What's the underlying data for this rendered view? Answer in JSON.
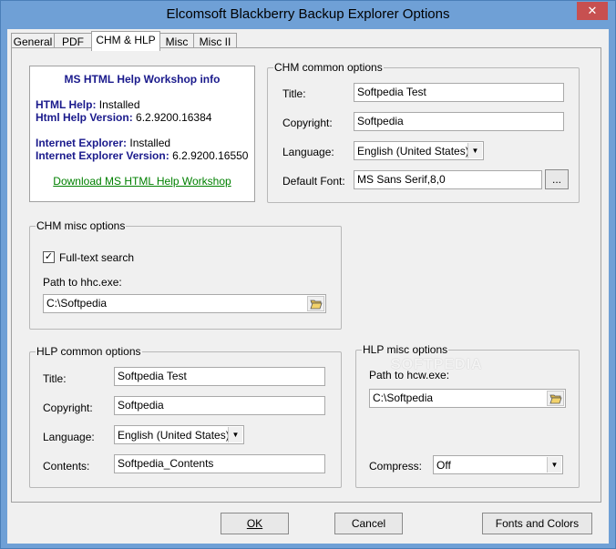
{
  "window": {
    "title": "Elcomsoft Blackberry Backup Explorer Options",
    "close_glyph": "✕"
  },
  "tabs": [
    {
      "label": "General"
    },
    {
      "label": "PDF"
    },
    {
      "label": "CHM & HLP"
    },
    {
      "label": "Misc"
    },
    {
      "label": "Misc II"
    }
  ],
  "active_tab": "CHM & HLP",
  "info": {
    "header": "MS HTML Help Workshop info",
    "html_help_label": "HTML Help:",
    "html_help_value": "Installed",
    "html_help_version_label": "Html Help Version:",
    "html_help_version_value": "6.2.9200.16384",
    "ie_label": "Internet Explorer:",
    "ie_value": "Installed",
    "ie_version_label": "Internet Explorer Version:",
    "ie_version_value": "6.2.9200.16550",
    "download_link": "Download MS HTML Help Workshop"
  },
  "chm_common": {
    "legend": "CHM common options",
    "title_label": "Title:",
    "title_value": "Softpedia Test",
    "copyright_label": "Copyright:",
    "copyright_value": "Softpedia",
    "language_label": "Language:",
    "language_value": "English (United States)",
    "font_label": "Default Font:",
    "font_value": "MS Sans Serif,8,0",
    "font_button": "..."
  },
  "chm_misc": {
    "legend": "CHM misc options",
    "fulltext_label": "Full-text search",
    "fulltext_checked": true,
    "path_label": "Path to hhc.exe:",
    "path_value": "C:\\Softpedia"
  },
  "hlp_common": {
    "legend": "HLP common options",
    "title_label": "Title:",
    "title_value": "Softpedia Test",
    "copyright_label": "Copyright:",
    "copyright_value": "Softpedia",
    "language_label": "Language:",
    "language_value": "English (United States)",
    "contents_label": "Contents:",
    "contents_value": "Softpedia_Contents"
  },
  "hlp_misc": {
    "legend": "HLP misc options",
    "path_label": "Path to hcw.exe:",
    "path_value": "C:\\Softpedia",
    "compress_label": "Compress:",
    "compress_value": "Off"
  },
  "watermark": "SOFTPEDIA",
  "buttons": {
    "ok_label": "OK",
    "cancel_label": "Cancel",
    "fonts_label": "Fonts and Colors"
  }
}
